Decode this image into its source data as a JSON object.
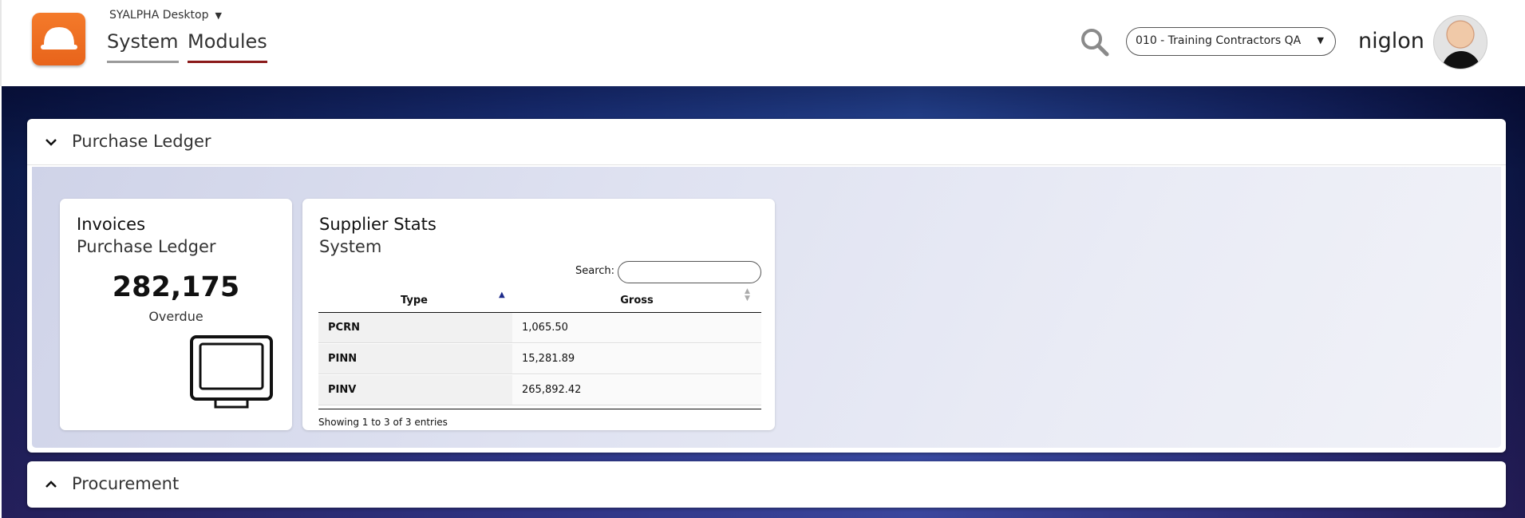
{
  "header": {
    "app_selector": "SYALPHA Desktop",
    "tabs": [
      {
        "label": "System"
      },
      {
        "label": "Modules"
      }
    ],
    "company_select": "010 - Training Contractors QA",
    "username": "niglon"
  },
  "panels": [
    {
      "title": "Purchase Ledger",
      "expanded": true,
      "cards": {
        "invoices": {
          "title": "Invoices",
          "subtitle": "Purchase Ledger",
          "value": "282,175",
          "label": "Overdue",
          "icon": "monitor-icon"
        },
        "supplier_stats": {
          "title": "Supplier Stats",
          "subtitle": "System",
          "search_label": "Search:",
          "search_value": "",
          "columns": [
            "Type",
            "Gross"
          ],
          "rows": [
            {
              "type": "PCRN",
              "gross": "1,065.50"
            },
            {
              "type": "PINN",
              "gross": "15,281.89"
            },
            {
              "type": "PINV",
              "gross": "265,892.42"
            }
          ],
          "info": "Showing 1 to 3 of 3 entries"
        }
      }
    },
    {
      "title": "Procurement",
      "expanded": false
    }
  ],
  "colors": {
    "brand_orange": "#f47a2a",
    "active_tab_underline": "#8b1a1a",
    "inactive_tab_underline": "#9a9a9a"
  }
}
